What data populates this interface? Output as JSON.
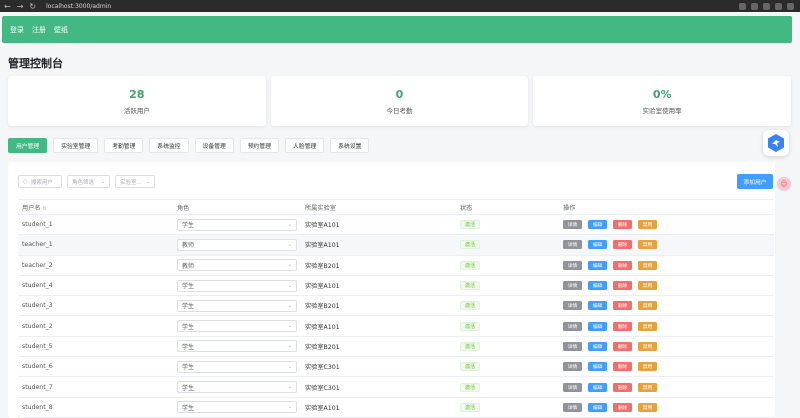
{
  "browser": {
    "url": "localhost:3000/admin"
  },
  "topnav": {
    "items": [
      "登录",
      "注册",
      "壁纸"
    ]
  },
  "page_title": "管理控制台",
  "stats": [
    {
      "value": "28",
      "label": "活跃用户"
    },
    {
      "value": "0",
      "label": "今日考勤"
    },
    {
      "value": "0%",
      "label": "实验室使用率"
    }
  ],
  "tabs": [
    "用户管理",
    "实验室管理",
    "考勤管理",
    "系统监控",
    "设备管理",
    "预约管理",
    "人脸管理",
    "系统设置"
  ],
  "filters": {
    "search_placeholder": "搜索用户",
    "role_placeholder": "角色筛选",
    "lab_placeholder": "实验室..."
  },
  "add_user_label": "添加用户",
  "table": {
    "headers": [
      "用户名",
      "角色",
      "所属实验室",
      "状态",
      "操作"
    ],
    "actions": [
      "详情",
      "编辑",
      "删除",
      "禁用"
    ],
    "rows": [
      {
        "username": "student_1",
        "role": "学生",
        "lab": "实验室A101",
        "status": "激活"
      },
      {
        "username": "teacher_1",
        "role": "教师",
        "lab": "实验室A101",
        "status": "激活"
      },
      {
        "username": "teacher_2",
        "role": "教师",
        "lab": "实验室B201",
        "status": "激活"
      },
      {
        "username": "student_4",
        "role": "学生",
        "lab": "实验室A101",
        "status": "激活"
      },
      {
        "username": "student_3",
        "role": "学生",
        "lab": "实验室B201",
        "status": "激活"
      },
      {
        "username": "student_2",
        "role": "学生",
        "lab": "实验室A101",
        "status": "激活"
      },
      {
        "username": "student_5",
        "role": "学生",
        "lab": "实验室B201",
        "status": "激活"
      },
      {
        "username": "student_6",
        "role": "学生",
        "lab": "实验室C301",
        "status": "激活"
      },
      {
        "username": "student_7",
        "role": "学生",
        "lab": "实验室C301",
        "status": "激活"
      },
      {
        "username": "student_8",
        "role": "学生",
        "lab": "实验室A101",
        "status": "激活"
      }
    ]
  },
  "colors": {
    "brand": "#42b983",
    "primary": "#409eff",
    "danger": "#f56c6c",
    "warning": "#e6a23c",
    "info": "#909399"
  }
}
